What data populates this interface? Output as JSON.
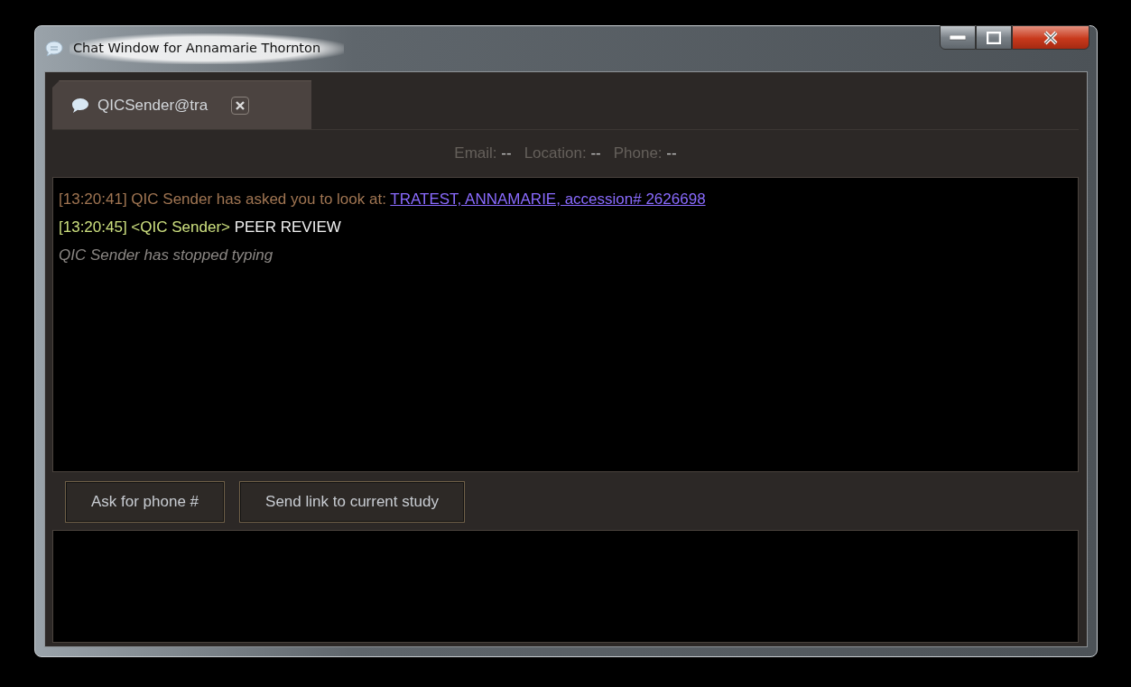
{
  "window": {
    "title": "Chat Window for Annamarie Thornton"
  },
  "tabs": [
    {
      "label": "QICSender@tra",
      "selected": true
    }
  ],
  "contact_info": [
    {
      "label": "Email:",
      "value": "--"
    },
    {
      "label": "Location:",
      "value": "--"
    },
    {
      "label": "Phone:",
      "value": "--"
    }
  ],
  "messages": [
    {
      "kind": "request",
      "time": "[13:20:41]",
      "text": "QIC Sender has asked you to look at:",
      "link": "TRATEST, ANNAMARIE, accession# 2626698"
    },
    {
      "kind": "chat",
      "time": "[13:20:45]",
      "sender": "<QIC Sender>",
      "text": "PEER REVIEW"
    },
    {
      "kind": "status",
      "text": "QIC Sender has stopped typing"
    }
  ],
  "buttons": [
    {
      "label": "Ask for phone #"
    },
    {
      "label": "Send link to current study"
    }
  ]
}
